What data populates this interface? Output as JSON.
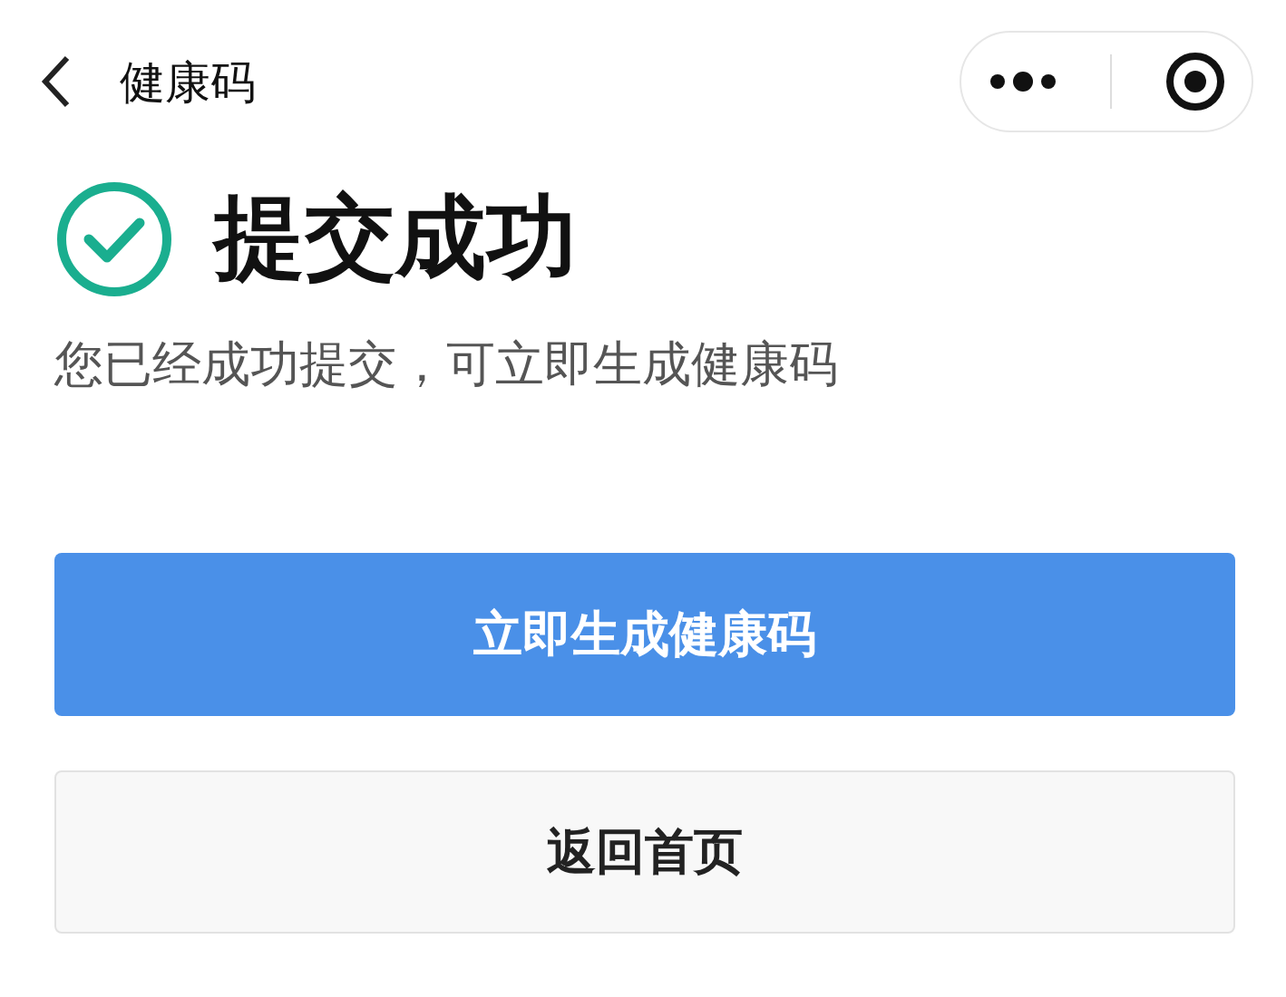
{
  "nav_bar": {
    "title": "健康码"
  },
  "result": {
    "title": "提交成功",
    "message": "您已经成功提交，可立即生成健康码"
  },
  "buttons": [
    {
      "label": "立即生成健康码",
      "kind": "primary"
    },
    {
      "label": "返回首页",
      "kind": "secondary"
    }
  ]
}
